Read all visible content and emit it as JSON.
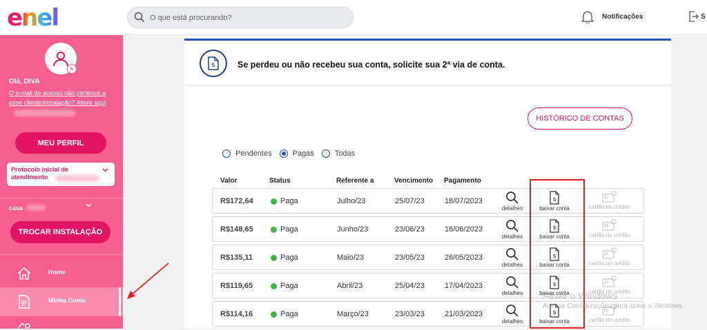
{
  "header": {
    "logo": "enel",
    "search_placeholder": "O que está procurando?",
    "notifications_label": "Notificações",
    "logout_label": "S"
  },
  "sidebar": {
    "greeting": "Olá, DIVA",
    "email_link": "O e-mail de acesso não pertence a esse cliente/instalação? Altere aqui",
    "profile_button": "MEU PERFIL",
    "protocol_label": "Protocolo inicial de atendimento",
    "installation_label": "casa",
    "switch_button": "TROCAR INSTALAÇÃO",
    "nav": [
      {
        "label": "Home",
        "icon": "home-icon"
      },
      {
        "label": "Minha Conta",
        "icon": "document-icon"
      }
    ]
  },
  "main": {
    "banner_title": "Se perdeu ou não recebeu sua conta, solicite sua 2ª via de conta.",
    "history_button": "HISTÓRICO DE CONTAS",
    "filters": [
      {
        "label": "Pendentes",
        "selected": false
      },
      {
        "label": "Pagas",
        "selected": true
      },
      {
        "label": "Todas",
        "selected": false
      }
    ],
    "columns": {
      "valor": "Valor",
      "status": "Status",
      "referente": "Referente a",
      "vencimento": "Vencimento",
      "pagamento": "Pagamento"
    },
    "actions": {
      "details": "detalhes",
      "download": "baixar conta",
      "credit_card": "cartão de crédito"
    },
    "rows": [
      {
        "valor": "R$172,64",
        "status": "Paga",
        "referente": "Julho/23",
        "vencimento": "25/07/23",
        "pagamento": "18/07/2023"
      },
      {
        "valor": "R$148,65",
        "status": "Paga",
        "referente": "Junho/23",
        "vencimento": "23/06/23",
        "pagamento": "16/06/2023"
      },
      {
        "valor": "R$135,11",
        "status": "Paga",
        "referente": "Maio/23",
        "vencimento": "23/05/23",
        "pagamento": "26/05/2023"
      },
      {
        "valor": "R$119,65",
        "status": "Paga",
        "referente": "Abril/23",
        "vencimento": "25/04/23",
        "pagamento": "17/04/2023"
      },
      {
        "valor": "R$114,16",
        "status": "Paga",
        "referente": "Março/23",
        "vencimento": "23/03/23",
        "pagamento": "21/03/2023"
      }
    ],
    "status_color": "#43b548"
  },
  "watermark": {
    "title": "Ativar o Windows",
    "text": "Acesse Configurações para ativar o Windows."
  },
  "colors": {
    "brand_pink": "#e31463",
    "sidebar_bg": "#f55e8e",
    "accent_blue": "#1f56b5",
    "highlight_red": "#e02020"
  }
}
